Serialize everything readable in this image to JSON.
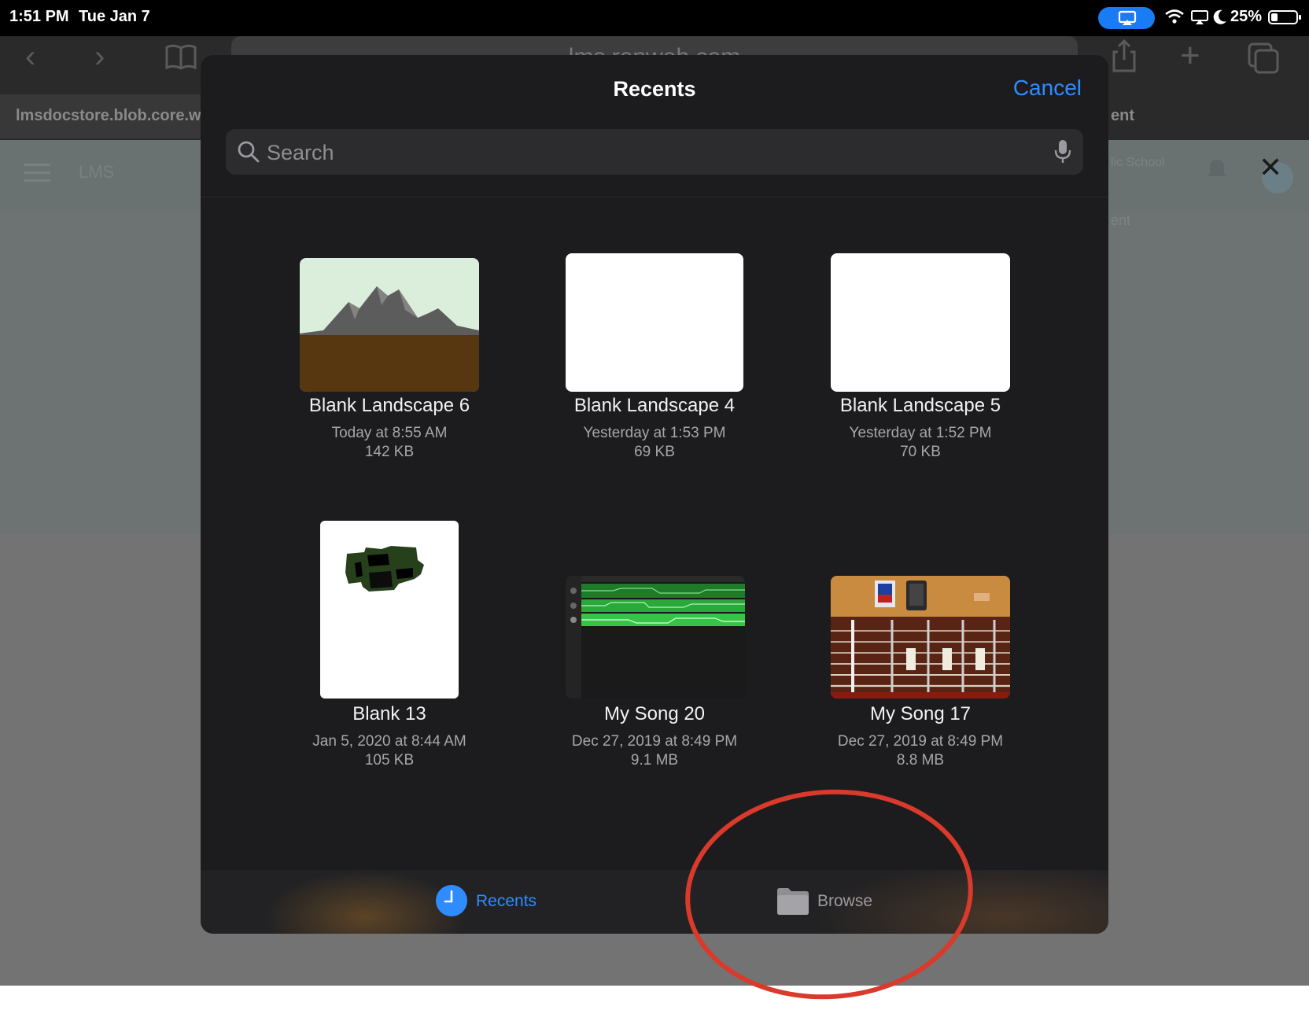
{
  "status_bar": {
    "time": "1:51 PM",
    "date": "Tue Jan 7",
    "battery_percent": "25%"
  },
  "browser": {
    "url": "lms.renweb.com",
    "left_tab": "lmsdocstore.blob.core.w",
    "right_tab": "ent"
  },
  "page_behind": {
    "app_label": "LMS",
    "school_label": "lic School",
    "side_text": "ent"
  },
  "modal": {
    "title": "Recents",
    "cancel_label": "Cancel",
    "search_placeholder": "Search"
  },
  "files": [
    {
      "name": "Blank Landscape 6",
      "date": "Today at 8:55 AM",
      "size": "142 KB",
      "thumb": "landscape"
    },
    {
      "name": "Blank Landscape 4",
      "date": "Yesterday at 1:53 PM",
      "size": "69 KB",
      "thumb": "blank"
    },
    {
      "name": "Blank Landscape 5",
      "date": "Yesterday at 1:52 PM",
      "size": "70 KB",
      "thumb": "blank"
    },
    {
      "name": "Blank 13",
      "date": "Jan 5, 2020 at 8:44 AM",
      "size": "105 KB",
      "thumb": "drawing"
    },
    {
      "name": "My Song 20",
      "date": "Dec 27, 2019 at 8:49 PM",
      "size": "9.1 MB",
      "thumb": "garageband-tracks"
    },
    {
      "name": "My Song 17",
      "date": "Dec 27, 2019 at 8:49 PM",
      "size": "8.8 MB",
      "thumb": "guitar"
    }
  ],
  "tabs": {
    "recents_label": "Recents",
    "browse_label": "Browse"
  },
  "colors": {
    "accent": "#2f8cff",
    "modal_bg": "#1c1c1e",
    "annotation": "#d93a2b"
  }
}
